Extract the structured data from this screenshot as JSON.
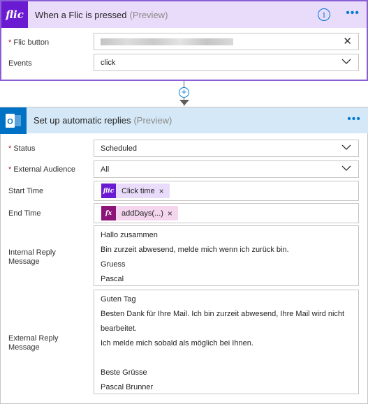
{
  "trigger": {
    "title": "When a Flic is pressed",
    "preview": "(Preview)",
    "flic_button_label": "Flic button",
    "events_label": "Events",
    "events_value": "click"
  },
  "action": {
    "title": "Set up automatic replies",
    "preview": "(Preview)",
    "status_label": "Status",
    "status_value": "Scheduled",
    "audience_label": "External Audience",
    "audience_value": "All",
    "start_label": "Start Time",
    "start_token": "Click time",
    "end_label": "End Time",
    "end_token": "addDays(...)",
    "internal_label": "Internal Reply Message",
    "internal_lines": [
      "Hallo zusammen",
      "Bin zurzeit abwesend, melde mich wenn ich zurück bin.",
      "Gruess",
      "Pascal"
    ],
    "external_label": "External Reply Message",
    "external_lines": [
      "Guten Tag",
      "Besten Dank für Ihre Mail. Ich bin zurzeit abwesend, Ihre Mail wird nicht",
      "bearbeitet.",
      "Ich melde mich sobald als möglich bei Ihnen.",
      "",
      "Beste Grüsse",
      "Pascal Brunner"
    ]
  },
  "icons": {
    "flic_logo": "flic",
    "outlook_logo": "O",
    "fx_logo": "fx"
  },
  "colors": {
    "flic_purple": "#6a1bd1",
    "outlook_blue": "#0072c6",
    "required_red": "#a4262c"
  }
}
